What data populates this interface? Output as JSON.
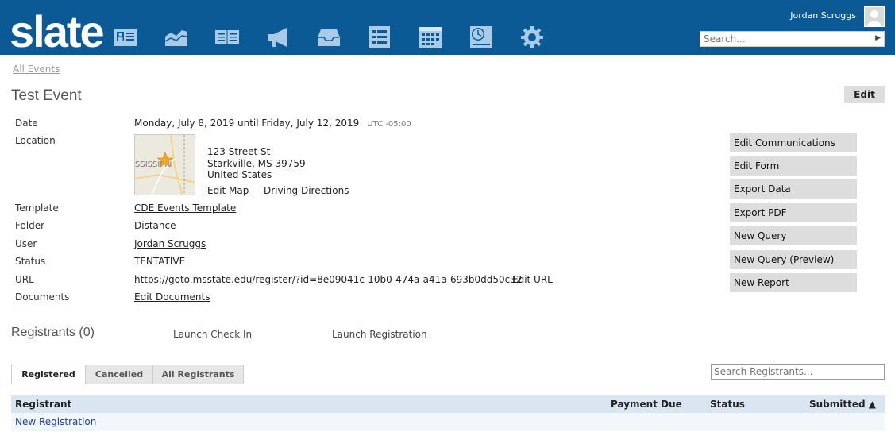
{
  "header": {
    "logo": "slate",
    "user_name": "Jordan Scruggs",
    "search_placeholder": "Search...",
    "nav_icons": [
      "contacts-icon",
      "dashboard-icon",
      "book-icon",
      "megaphone-icon",
      "inbox-icon",
      "list-icon",
      "calendar-icon",
      "clock-icon",
      "gear-icon"
    ]
  },
  "breadcrumb": "All Events",
  "title": "Test Event",
  "edit_label": "Edit",
  "details": {
    "date_label": "Date",
    "date_value": "Monday, July 8, 2019 until Friday, July 12, 2019",
    "timezone": "UTC -05:00",
    "location_label": "Location",
    "map_text": "SSISSIPPI",
    "address_line1": "123 Street St",
    "address_line2": "Starkville, MS 39759",
    "address_line3": "United States",
    "edit_map": "Edit Map",
    "driving_directions": "Driving Directions",
    "template_label": "Template",
    "template_value": "CDE Events Template",
    "folder_label": "Folder",
    "folder_value": "Distance",
    "user_label": "User",
    "user_value": "Jordan Scruggs",
    "status_label": "Status",
    "status_value": "TENTATIVE",
    "url_label": "URL",
    "url_value": "https://goto.msstate.edu/register/?id=8e09041c-10b0-474a-a41a-693b0dd50c32",
    "edit_url": "Edit URL",
    "documents_label": "Documents",
    "documents_value": "Edit Documents"
  },
  "actions": [
    "Edit Communications",
    "Edit Form",
    "Export Data",
    "Export PDF",
    "New Query",
    "New Query (Preview)",
    "New Report"
  ],
  "registrants": {
    "title": "Registrants (0)",
    "launch_check_in": "Launch Check In",
    "launch_registration": "Launch Registration",
    "tabs": [
      "Registered",
      "Cancelled",
      "All Registrants"
    ],
    "search_placeholder": "Search Registrants...",
    "columns": [
      "Registrant",
      "Payment Due",
      "Status",
      "Submitted ▲"
    ],
    "new_registration": "New Registration"
  },
  "colors": {
    "header_bg": "#0c5a95",
    "icon_color": "#a9cbe8",
    "link": "#1a3fb5",
    "table_header_bg": "#d9e5f0",
    "button_bg": "#dddddd"
  }
}
